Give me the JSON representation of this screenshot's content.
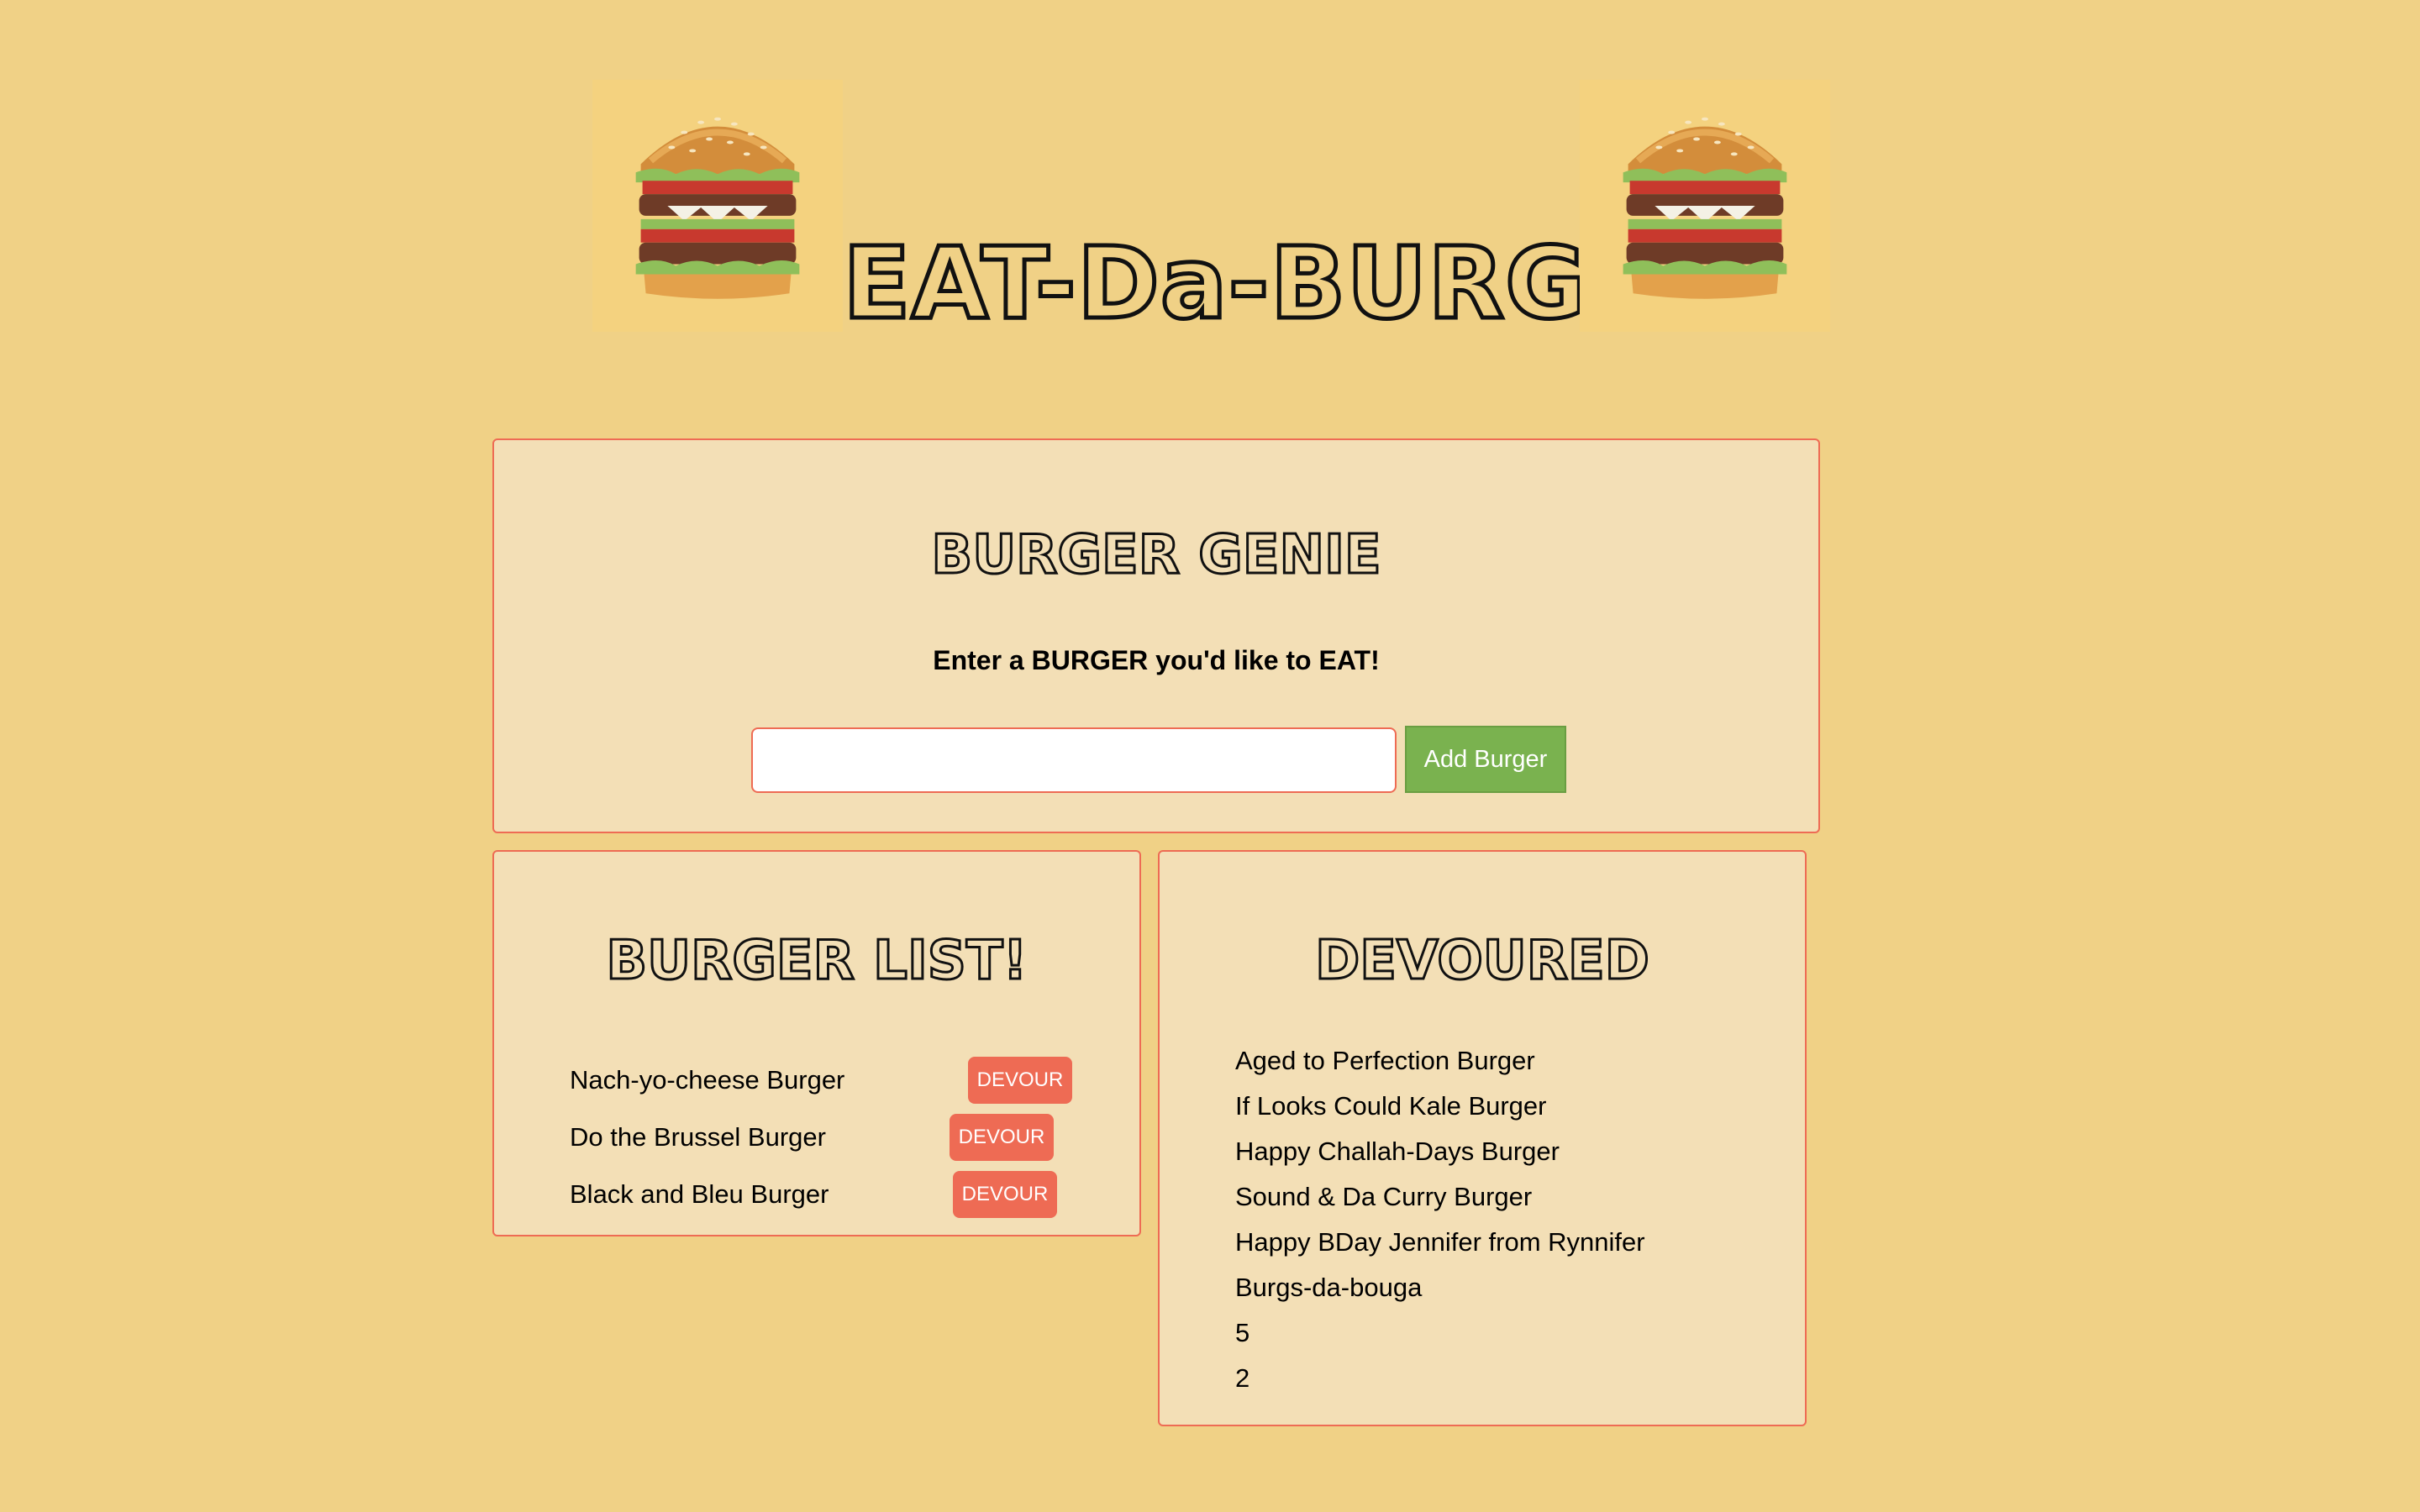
{
  "colors": {
    "page_background": "#f0d186",
    "panel_background": "#f3dfb6",
    "panel_border": "#ee6b54",
    "add_button": "#7ab24f",
    "devour_button": "#ee6b54"
  },
  "header": {
    "title": "EAT-Da-BURGER",
    "left_image_icon": "burger-icon",
    "right_image_icon": "burger-icon"
  },
  "genie": {
    "title": "BURGER GENIE",
    "prompt": "Enter a BURGER you'd like to EAT!",
    "input_value": "",
    "add_button_label": "Add Burger"
  },
  "burger_list": {
    "title": "BURGER LIST!",
    "items": [
      {
        "name": "Nach-yo-cheese Burger",
        "button_label": "DEVOUR"
      },
      {
        "name": "Do the Brussel Burger",
        "button_label": "DEVOUR"
      },
      {
        "name": "Black and Bleu Burger",
        "button_label": "DEVOUR"
      }
    ]
  },
  "devoured": {
    "title": "DEVOURED",
    "items": [
      "Aged to Perfection Burger",
      "If Looks Could Kale Burger",
      "Happy Challah-Days Burger",
      "Sound & Da Curry Burger",
      "Happy BDay Jennifer from Rynnifer",
      "Burgs-da-bouga",
      "5",
      "2"
    ]
  }
}
